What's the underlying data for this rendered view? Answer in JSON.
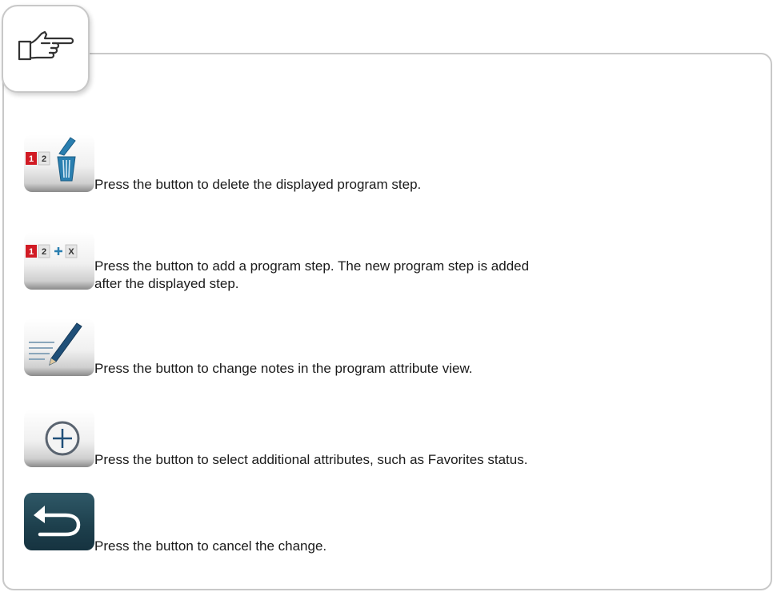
{
  "note_icon": "pointing-hand-icon",
  "items": [
    {
      "icon": "delete-program-step-icon",
      "badge_a": "1",
      "badge_b": "2",
      "text": "Press the button to delete the displayed program step."
    },
    {
      "icon": "add-program-step-icon",
      "badge_a": "1",
      "badge_b": "2",
      "badge_c": "X",
      "text_line1": "Press the button to add a program step. The new program step is added",
      "text_line2": "after the displayed step."
    },
    {
      "icon": "edit-notes-pen-icon",
      "text": "Press the button to change notes in the program attribute view."
    },
    {
      "icon": "plus-circle-icon",
      "text": "Press the button to select additional attributes, such as Favorites status."
    },
    {
      "icon": "back-arrow-icon",
      "text": "Press the button to cancel the change."
    }
  ],
  "colors": {
    "badge_red": "#d11b24",
    "frame": "#c8c8c8",
    "dark_button": "#1d3f4c"
  }
}
